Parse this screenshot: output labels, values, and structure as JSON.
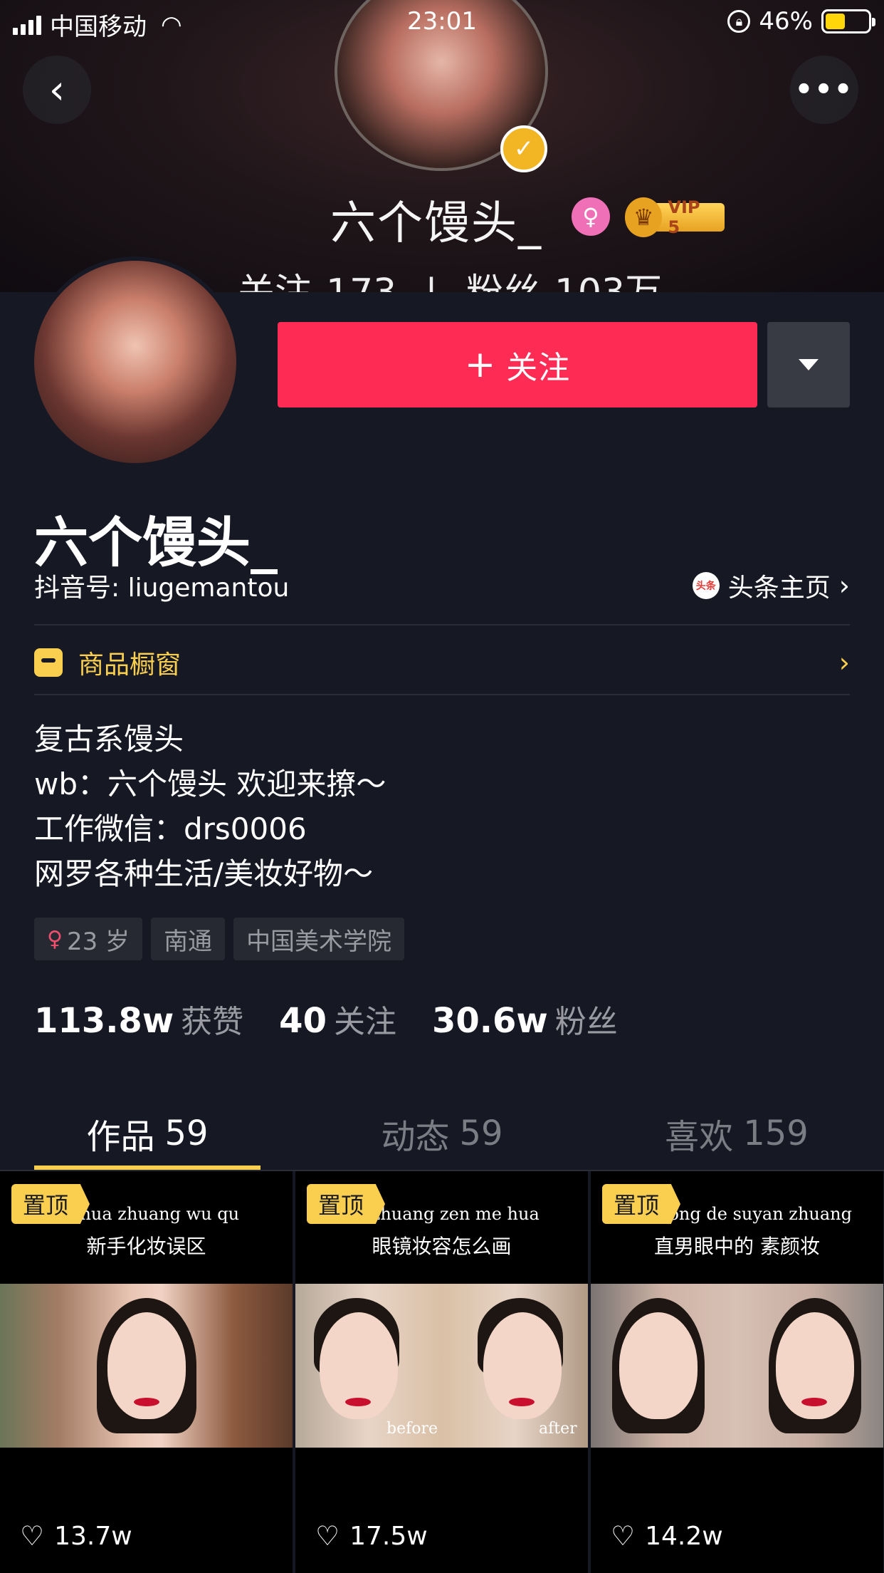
{
  "status_bar": {
    "carrier": "中国移动",
    "time": "23:01",
    "battery": "46%",
    "battery_level": 0.46
  },
  "banner": {
    "name": "六个馒头_",
    "vip_label": "VIP 5",
    "following_label": "关注",
    "following_count": "173",
    "fans_label": "粉丝",
    "fans_count": "103万"
  },
  "actions": {
    "follow_label": "关注"
  },
  "profile": {
    "name": "六个馒头_",
    "douyin_id": "抖音号: liugemantou",
    "toutiao_label": "头条主页",
    "toutiao_icon_text": "头条",
    "shop_label": "商品橱窗",
    "bio": [
      "复古系馒头",
      "wb：六个馒头  欢迎来撩～",
      "工作微信：drs0006",
      "网罗各种生活/美妆好物～"
    ],
    "tags": [
      "23 岁",
      "南通",
      "中国美术学院"
    ]
  },
  "counts": [
    {
      "value": "113.8w",
      "label": "获赞"
    },
    {
      "value": "40",
      "label": "关注"
    },
    {
      "value": "30.6w",
      "label": "粉丝"
    }
  ],
  "tabs": [
    {
      "label": "作品",
      "count": "59",
      "active": true
    },
    {
      "label": "动态",
      "count": "59",
      "active": false
    },
    {
      "label": "喜欢",
      "count": "159",
      "active": false
    }
  ],
  "videos": [
    {
      "pin": "置顶",
      "caption_pinyin": "ou hua zhuang wu qu",
      "caption": "新手化妆误区",
      "likes": "13.7w"
    },
    {
      "pin": "置顶",
      "caption_pinyin": "ng zhuang zen me hua",
      "caption": "眼镜妆容怎么画",
      "likes": "17.5w",
      "photo_labels": [
        "before",
        "after"
      ]
    },
    {
      "pin": "置顶",
      "caption_pinyin": "an zhong de suyan zhuang",
      "caption": "直男眼中的 素颜妆",
      "likes": "14.2w"
    }
  ],
  "colors": {
    "background": "#161823",
    "follow_button": "#fe2c55",
    "accent_yellow": "#facf4f"
  },
  "icons": [
    "back-icon",
    "more-icon",
    "verified-icon",
    "female-icon",
    "crown-icon",
    "dropdown-icon",
    "toutiao-icon",
    "shop-icon",
    "chevron-right-icon",
    "heart-icon"
  ]
}
